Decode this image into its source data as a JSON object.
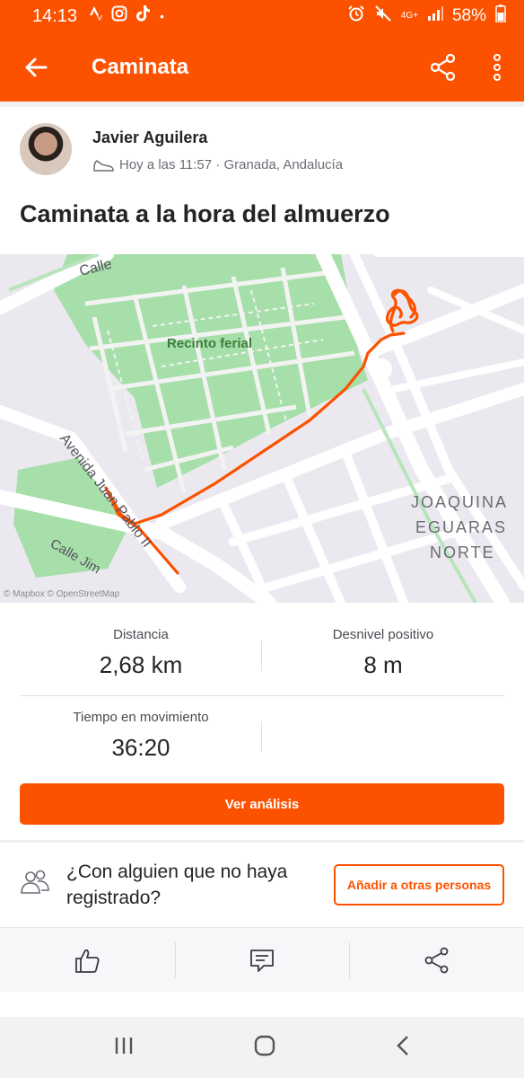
{
  "status_bar": {
    "time": "14:13",
    "network": "4G+",
    "battery": "58%"
  },
  "app_bar": {
    "title": "Caminata"
  },
  "activity": {
    "athlete_name": "Javier Aguilera",
    "timestamp_location": "Hoy a las 11:57 · Granada, Andalucía",
    "title": "Caminata a la hora del almuerzo"
  },
  "map": {
    "labels": {
      "park": "Recinto ferial",
      "street_top": "Calle",
      "avenue": "Avenida Juan Pablo II",
      "street_bottom": "Calle Jim",
      "district_line1": "JOAQUINA",
      "district_line2": "EGUARAS",
      "district_line3": "NORTE",
      "credit": "© Mapbox © OpenStreetMap"
    },
    "route_color": "#fc5200",
    "park_color": "#a6dfa9"
  },
  "stats": {
    "distance_label": "Distancia",
    "distance_value": "2,68 km",
    "elevation_label": "Desnivel positivo",
    "elevation_value": "8 m",
    "moving_time_label": "Tiempo en movimiento",
    "moving_time_value": "36:20",
    "analysis_button": "Ver análisis"
  },
  "add_people": {
    "question": "¿Con alguien que no haya registrado?",
    "button": "Añadir a otras personas"
  },
  "social": {
    "icons": [
      "thumbs-up-icon",
      "comment-icon",
      "share-icon"
    ]
  },
  "colors": {
    "brand": "#fc5200",
    "text": "#242428",
    "muted": "#6d6d78"
  }
}
